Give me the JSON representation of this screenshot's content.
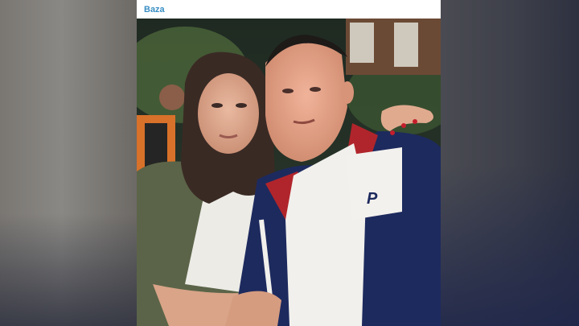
{
  "post": {
    "channel_name": "Baza"
  },
  "photo": {
    "jacket_logo_text": "P",
    "colors": {
      "channel_accent": "#3a8fc4",
      "jacket_navy": "#1d2a5e",
      "jacket_red": "#b0252b",
      "shirt_white": "#f1f0ec",
      "olive_jacket": "#5b6448"
    }
  }
}
